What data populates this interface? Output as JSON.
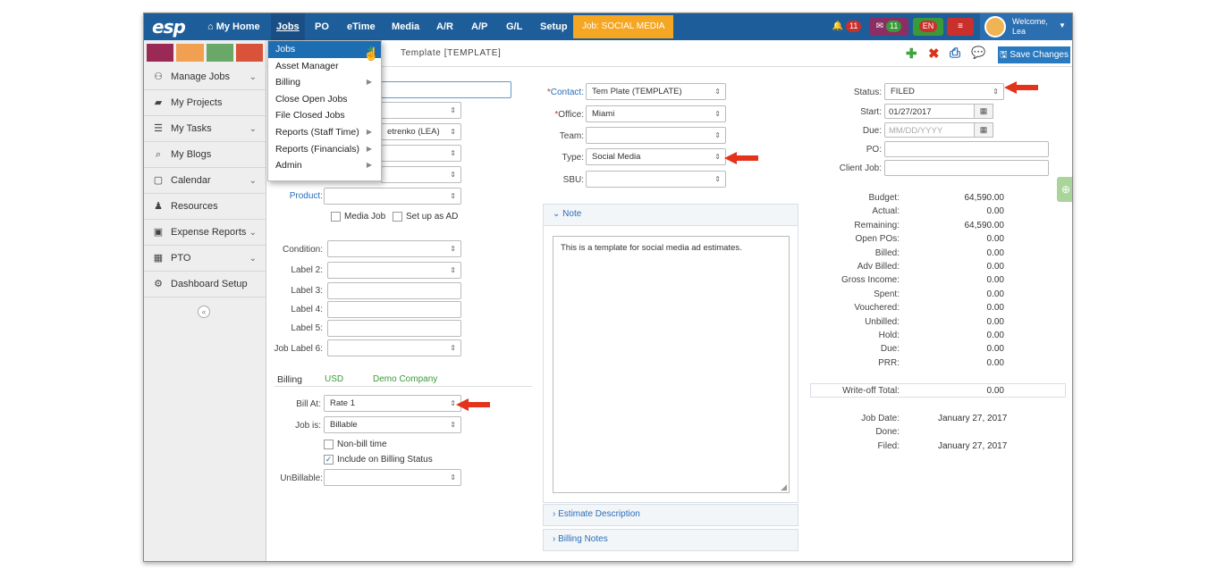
{
  "app": {
    "logo": "esp"
  },
  "nav": {
    "home": "My Home",
    "items": [
      "Jobs",
      "PO",
      "eTime",
      "Media",
      "A/R",
      "A/P",
      "G/L",
      "Setup"
    ],
    "job_badge": "Job: SOCIAL MEDIA"
  },
  "header_icons": {
    "bell_count": "11",
    "mail_count": "11",
    "lang": "EN",
    "welcome": "Welcome,",
    "user": "Lea"
  },
  "swatch_colors": [
    "#9a2a55",
    "#f0a050",
    "#6aa86a",
    "#d9533a"
  ],
  "sidebar": {
    "items": [
      {
        "label": "Manage Jobs",
        "icon": "sitemap-icon",
        "chevron": true
      },
      {
        "label": "My Projects",
        "icon": "folder-icon",
        "chevron": false
      },
      {
        "label": "My Tasks",
        "icon": "tasks-icon",
        "chevron": true
      },
      {
        "label": "My Blogs",
        "icon": "comments-icon",
        "chevron": false
      },
      {
        "label": "Calendar",
        "icon": "calendar-icon",
        "chevron": true
      },
      {
        "label": "Resources",
        "icon": "users-icon",
        "chevron": false
      },
      {
        "label": "Expense Reports",
        "icon": "money-icon",
        "chevron": true
      },
      {
        "label": "PTO",
        "icon": "calendar-grid-icon",
        "chevron": true
      },
      {
        "label": "Dashboard Setup",
        "icon": "cogs-icon",
        "chevron": false
      }
    ],
    "collapse": "«"
  },
  "page": {
    "title": "Template [TEMPLATE]",
    "save": "Save Changes"
  },
  "jobs_menu": [
    {
      "label": "Jobs",
      "sub": false
    },
    {
      "label": "Asset Manager",
      "sub": false
    },
    {
      "label": "Billing",
      "sub": true
    },
    {
      "label": "Close Open Jobs",
      "sub": false
    },
    {
      "label": "File Closed Jobs",
      "sub": false
    },
    {
      "label": "Reports (Staff Time)",
      "sub": true
    },
    {
      "label": "Reports (Financials)",
      "sub": true
    },
    {
      "label": "Admin",
      "sub": true
    }
  ],
  "left_form": {
    "partial_select": "etrenko (LEA)",
    "product_label": "Product:",
    "media_job": "Media Job",
    "set_up_ad": "Set up as AD",
    "condition": "Condition:",
    "label2": "Label 2:",
    "label3": "Label 3:",
    "label4": "Label 4:",
    "label5": "Label 5:",
    "job_label6": "Job Label 6:",
    "billing": "Billing",
    "currency": "USD",
    "company": "Demo Company",
    "bill_at": "Bill At:",
    "bill_at_value": "Rate 1",
    "job_is": "Job is:",
    "job_is_value": "Billable",
    "non_bill": "Non-bill time",
    "include_billing": "Include on Billing Status",
    "unbillable": "UnBillable:"
  },
  "mid_form": {
    "contact": "Contact:",
    "contact_value": "Tem Plate (TEMPLATE)",
    "office": "Office:",
    "office_value": "Miami",
    "team": "Team:",
    "type": "Type:",
    "type_value": "Social Media",
    "sbu": "SBU:",
    "note_header": "Note",
    "note_text": "This is a template for social media ad estimates.",
    "estimate_desc": "Estimate Description",
    "billing_notes": "Billing Notes"
  },
  "right_form": {
    "status": "Status:",
    "status_value": "FILED",
    "start": "Start:",
    "start_value": "01/27/2017",
    "due": "Due:",
    "due_placeholder": "MM/DD/YYYY",
    "po": "PO:",
    "client_job": "Client Job:"
  },
  "financials": [
    {
      "label": "Budget:",
      "value": "64,590.00"
    },
    {
      "label": "Actual:",
      "value": "0.00"
    },
    {
      "label": "Remaining:",
      "value": "64,590.00"
    },
    {
      "label": "Open POs:",
      "value": "0.00",
      "link": true
    },
    {
      "label": "Billed:",
      "value": "0.00"
    },
    {
      "label": "Adv Billed:",
      "value": "0.00"
    },
    {
      "label": "Gross Income:",
      "value": "0.00"
    },
    {
      "label": "Spent:",
      "value": "0.00"
    },
    {
      "label": "Vouchered:",
      "value": "0.00"
    },
    {
      "label": "Unbilled:",
      "value": "0.00"
    },
    {
      "label": "Hold:",
      "value": "0.00"
    },
    {
      "label": "Due:",
      "value": "0.00"
    },
    {
      "label": "PRR:",
      "value": "0.00"
    }
  ],
  "writeoff": {
    "label": "Write-off Total:",
    "value": "0.00"
  },
  "dates": [
    {
      "label": "Job Date:",
      "value": "January 27, 2017"
    },
    {
      "label": "Done:",
      "value": ""
    },
    {
      "label": "Filed:",
      "value": "January 27, 2017"
    }
  ]
}
